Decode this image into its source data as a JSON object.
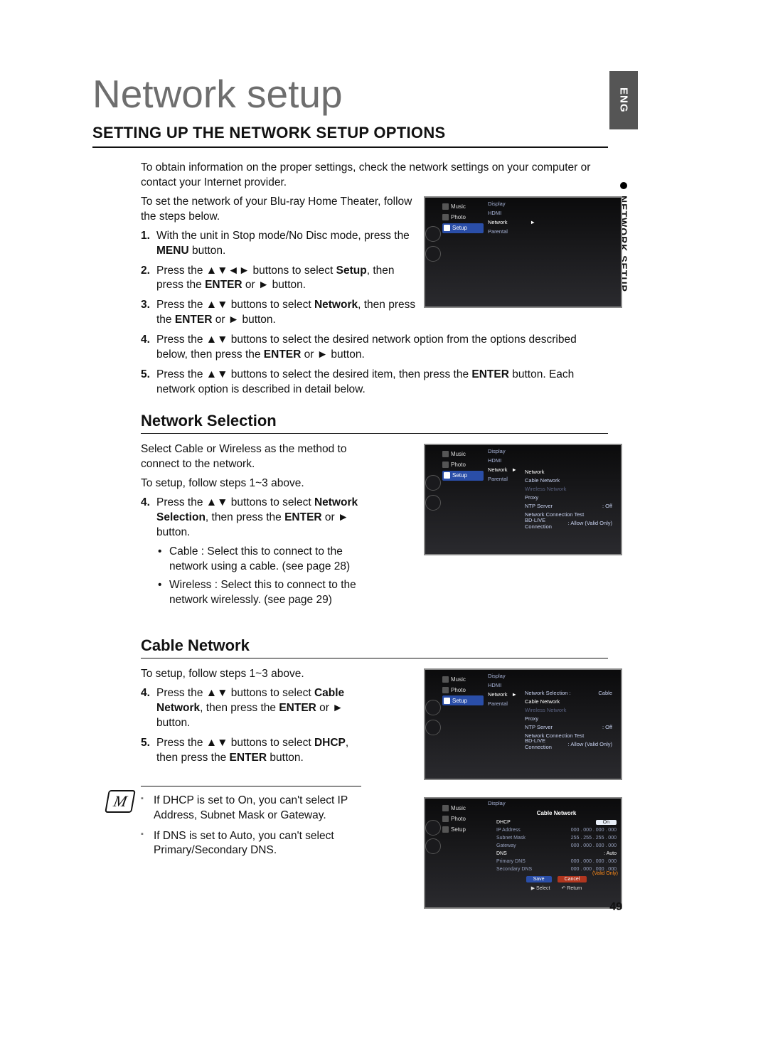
{
  "eng_tab": "ENG",
  "side_label": "NETWORK SETUP",
  "title": "Network setup",
  "section_heading": "SETTING UP THE NETWORK SETUP OPTIONS",
  "intro1": "To obtain information on the proper settings, check the network settings on your computer or contact your Internet provider.",
  "intro2": "To set the network of your Blu-ray Home Theater, follow the steps below.",
  "steps_common": {
    "s1a": "With the unit in Stop mode/No Disc mode, press the ",
    "s1b": "MENU",
    "s1c": " button.",
    "s2a": "Press the ▲▼◄► buttons to select ",
    "s2b": "Setup",
    "s2c": ", then press the ",
    "s2d": "ENTER",
    "s2e": " or ► button.",
    "s3a": "Press the ▲▼ buttons to select ",
    "s3b": "Network",
    "s3c": ", then press the ",
    "s3d": "ENTER",
    "s3e": " or ► button.",
    "s4a": "Press the ▲▼ buttons to select the desired network option from the options described below, then press the ",
    "s4b": "ENTER",
    "s4c": " or ► button.",
    "s5a": "Press the ▲▼ buttons to select the desired item, then press the ",
    "s5b": "ENTER",
    "s5c": " button. Each network option is described in detail below."
  },
  "nums": {
    "n1": "1.",
    "n2": "2.",
    "n3": "3.",
    "n4": "4.",
    "n5": "5."
  },
  "network_selection": {
    "heading": "Network Selection",
    "p1": "Select Cable or Wireless as the method to connect to the network.",
    "p2": "To setup, follow steps 1~3 above.",
    "s4a": "Press the ▲▼ buttons to select ",
    "s4b": "Network Selection",
    "s4c": ", then press the ",
    "s4d": "ENTER",
    "s4e": " or ► button.",
    "cable_b": "Cable",
    "cable_t": " : Select this to connect to the network using a cable. (see page 28)",
    "wireless_b": "Wireless",
    "wireless_t": " : Select this to connect to the network wirelessly. (see page 29)"
  },
  "cable_network": {
    "heading": "Cable Network",
    "p1": "To setup, follow steps 1~3 above.",
    "s4a": "Press the ▲▼ buttons to select ",
    "s4b": "Cable Network",
    "s4c": ", then press the ",
    "s4d": "ENTER",
    "s4e": " or ► button.",
    "s5a": "Press the ▲▼ buttons to select ",
    "s5b": "DHCP",
    "s5c": ", then press the ",
    "s5d": "ENTER",
    "s5e": " button."
  },
  "notes": {
    "n1a": "If DHCP is set to ",
    "n1b": "On",
    "n1c": ", you can't select IP Address, Subnet Mask or Gateway.",
    "n2a": "If DNS is set to ",
    "n2b": "Auto",
    "n2c": ", you can't select Primary/Secondary DNS."
  },
  "page_number": "49",
  "ss_side": {
    "music": "Music",
    "photo": "Photo",
    "setup": "Setup"
  },
  "ss1_menu": {
    "display": "Display",
    "hdmi": "HDMI",
    "network": "Network",
    "parental": "Parental"
  },
  "ss2_panel": {
    "title_row": "Network",
    "cable_net": "Cable Network",
    "wireless_net": "Wireless Network",
    "proxy": "Proxy",
    "ntp": "NTP Server",
    "ntp_v": ": Off",
    "test": "Network Connection Test",
    "bd": "BD-LIVE",
    "bd2": "Connection",
    "bd_v": ": Allow (Valid Only)",
    "netsel": "Network Selection :",
    "netsel_v": "Cable",
    "cable_hl": "Cable Network"
  },
  "ss4": {
    "title": "Cable Network",
    "dhcp": "DHCP",
    "dhcp_v": "On",
    "ip": "IP Address",
    "ip_v": "000 . 000 . 000 . 000",
    "sm": "Subnet Mask",
    "sm_v": "255 . 255 . 255 . 000",
    "gw": "Gateway",
    "gw_v": "000 . 000 . 000 . 000",
    "dns": "DNS",
    "dns_v": ": Auto",
    "pdns": "Primary DNS",
    "pdns_v": "000 . 000 . 000 . 000",
    "sdns": "Secondary DNS",
    "sdns_v": "000 . 000 . 000 . 000",
    "save": "Save",
    "cancel": "Cancel",
    "select": "Select",
    "return": "Return",
    "valid": "(Valid Only)"
  }
}
